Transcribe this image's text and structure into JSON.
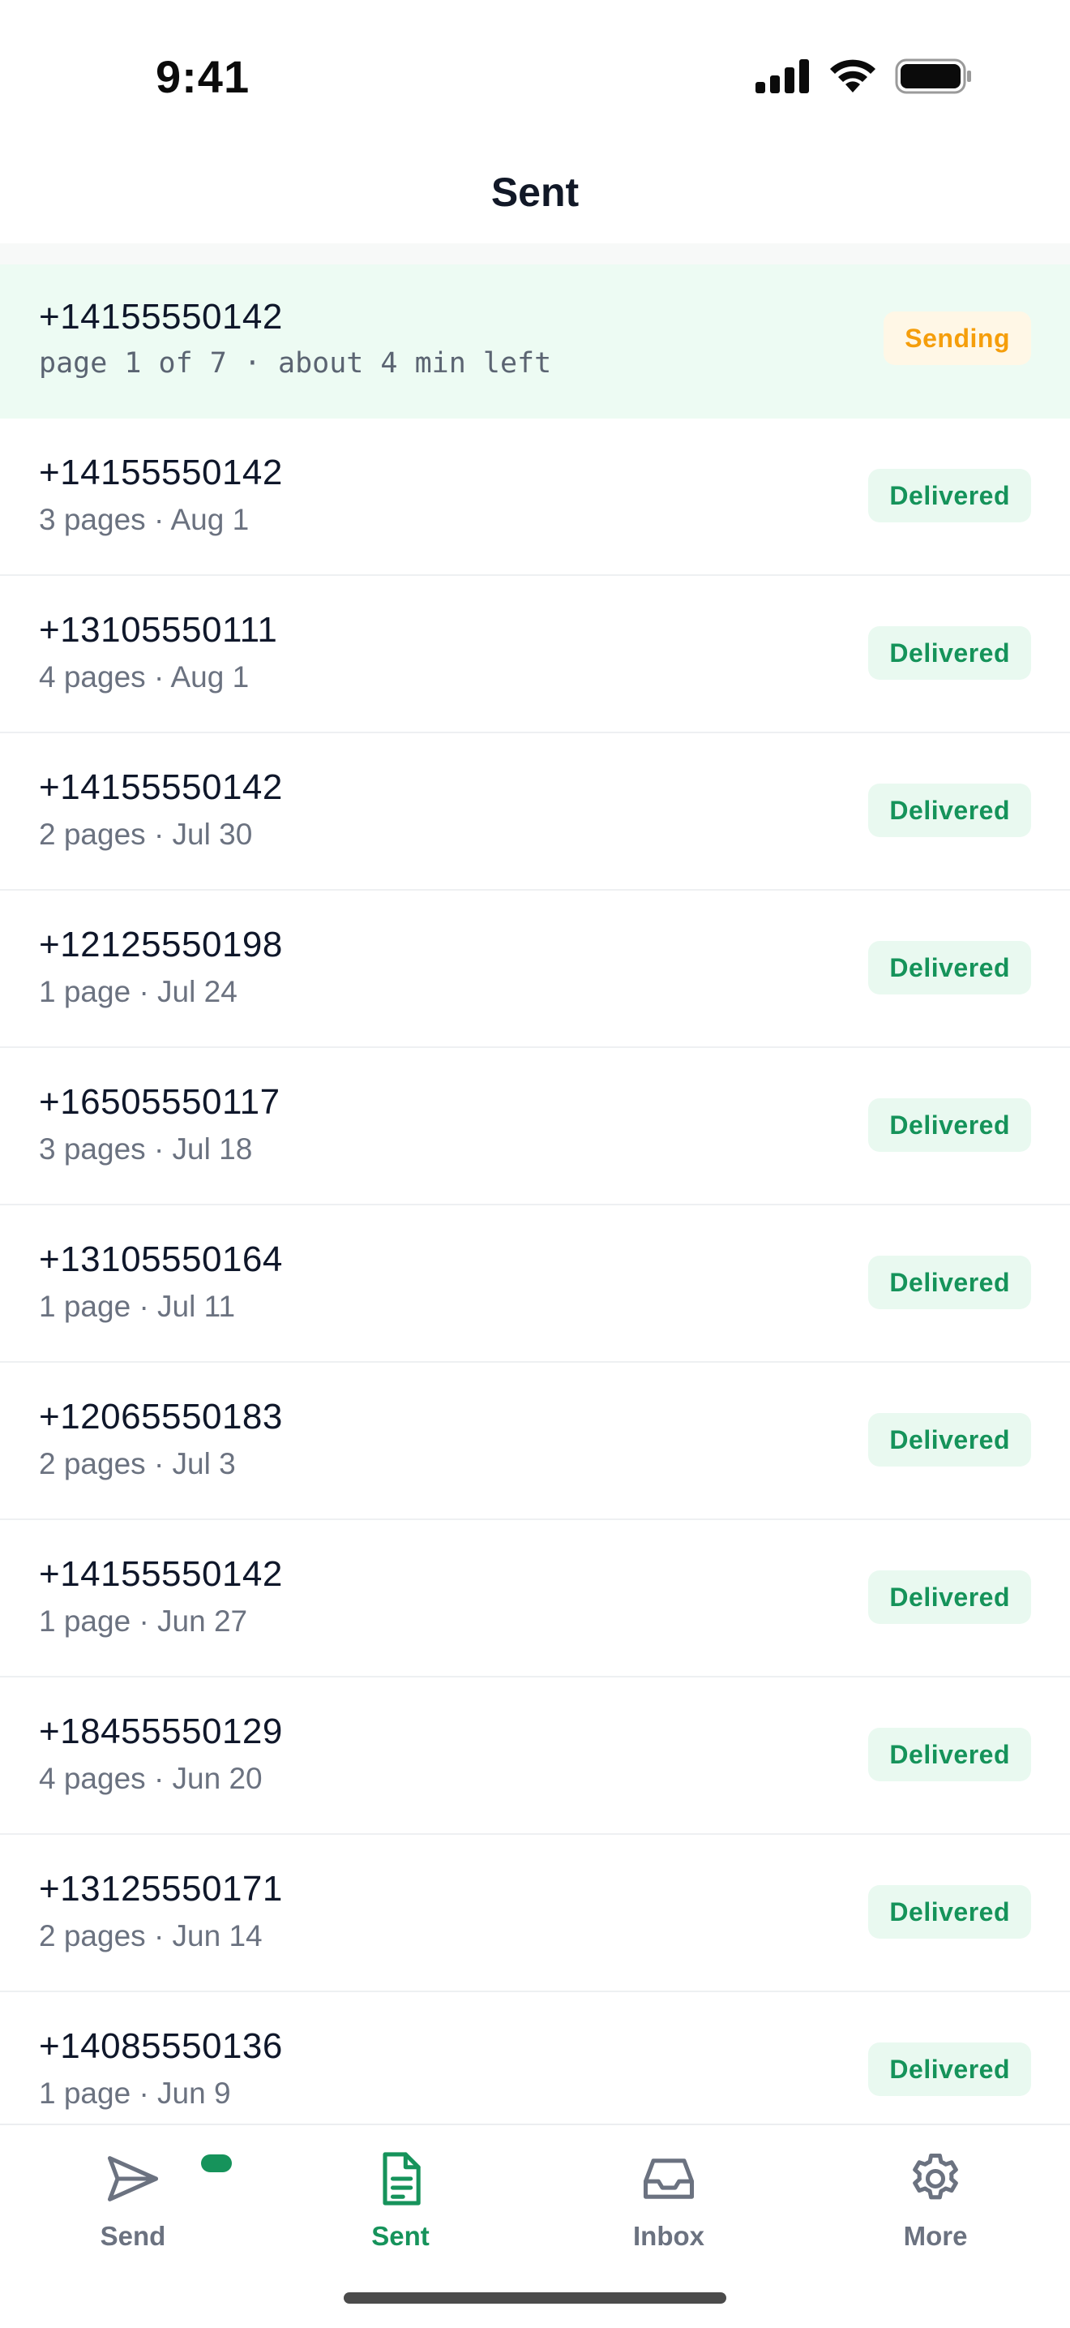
{
  "status_bar": {
    "time": "9:41"
  },
  "header": {
    "title": "Sent"
  },
  "faxes": [
    {
      "number": "+14155550142",
      "detail": "page 1 of 7 · about 4 min left",
      "status": "Sending"
    },
    {
      "number": "+14155550142",
      "detail": "3 pages · Aug 1",
      "status": "Delivered"
    },
    {
      "number": "+13105550111",
      "detail": "4 pages · Aug 1",
      "status": "Delivered"
    },
    {
      "number": "+14155550142",
      "detail": "2 pages · Jul 30",
      "status": "Delivered"
    },
    {
      "number": "+12125550198",
      "detail": "1 page · Jul 24",
      "status": "Delivered"
    },
    {
      "number": "+16505550117",
      "detail": "3 pages · Jul 18",
      "status": "Delivered"
    },
    {
      "number": "+13105550164",
      "detail": "1 page · Jul 11",
      "status": "Delivered"
    },
    {
      "number": "+12065550183",
      "detail": "2 pages · Jul 3",
      "status": "Delivered"
    },
    {
      "number": "+14155550142",
      "detail": "1 page · Jun 27",
      "status": "Delivered"
    },
    {
      "number": "+18455550129",
      "detail": "4 pages · Jun 20",
      "status": "Delivered"
    },
    {
      "number": "+13125550171",
      "detail": "2 pages · Jun 14",
      "status": "Delivered"
    },
    {
      "number": "+14085550136",
      "detail": "1 page · Jun 9",
      "status": "Delivered"
    }
  ],
  "tabs": [
    {
      "label": "Send",
      "icon": "send-icon",
      "selected": false
    },
    {
      "label": "Sent",
      "icon": "document-icon",
      "selected": true
    },
    {
      "label": "Inbox",
      "icon": "inbox-icon",
      "selected": false
    },
    {
      "label": "More",
      "icon": "gear-icon",
      "selected": false
    }
  ],
  "colors": {
    "accent": "#16935b",
    "sending_text": "#f59e0b",
    "sending_bg": "#fff7e6",
    "delivered_bg": "#e9f9f0",
    "active_row_bg": "#edfbf3"
  }
}
